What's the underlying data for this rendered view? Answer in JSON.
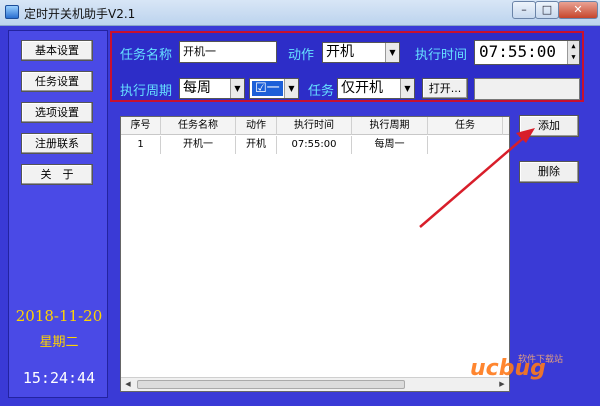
{
  "window": {
    "title": "定时开关机助手V2.1"
  },
  "sidebar": {
    "buttons": [
      "基本设置",
      "任务设置",
      "选项设置",
      "注册联系",
      "关　于"
    ],
    "date": "2018-11-20",
    "weekday": "星期二",
    "clock": "15:24:44"
  },
  "form": {
    "task_name_label": "任务名称",
    "task_name_value": "开机一",
    "action_label": "动作",
    "action_value": "开机",
    "exec_time_label": "执行时间",
    "exec_time_value": "07:55:00",
    "cycle_label": "执行周期",
    "cycle_value": "每周",
    "day_value": "一",
    "task_label": "任务",
    "task_value": "仅开机",
    "open_button": "打开..."
  },
  "table": {
    "columns": [
      "序号",
      "任务名称",
      "动作",
      "执行时间",
      "执行周期",
      "任务"
    ],
    "rows": [
      [
        "1",
        "开机一",
        "开机",
        "07:55:00",
        "每周一",
        ""
      ]
    ]
  },
  "actions": {
    "add": "添加",
    "delete": "删除"
  },
  "watermark": {
    "text": "ucbug",
    "sub": "软件下载站"
  },
  "colors": {
    "panel_bg": "#3a3ad6",
    "highlight_border": "#c8102e",
    "label_cyan": "#66e0ff",
    "date_yellow": "#ffd400",
    "arrow_red": "#d81e2a"
  }
}
